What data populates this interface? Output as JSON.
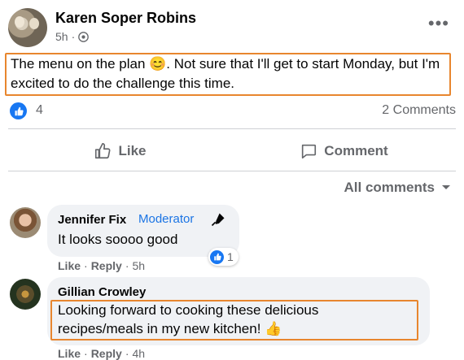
{
  "post": {
    "author": "Karen Soper Robins",
    "time": "5h",
    "separator": "·",
    "text": "The menu on the plan 😊. Not sure that I'll get to start Monday, but I'm excited to do the challenge this time.",
    "reaction_count": "4",
    "comment_count": "2 Comments"
  },
  "actions": {
    "like": "Like",
    "comment": "Comment"
  },
  "comments_filter": "All comments",
  "comments": [
    {
      "name": "Jennifer Fix",
      "badge": "Moderator",
      "text": "It looks soooo good",
      "like": "Like",
      "reply": "Reply",
      "time": "5h",
      "reaction_count": "1"
    },
    {
      "name": "Gillian Crowley",
      "text_line1": "Looking forward to cooking these delicious",
      "text_line2": "recipes/meals in my new kitchen! 👍",
      "like": "Like",
      "reply": "Reply",
      "time": "4h"
    }
  ],
  "colors": {
    "accent": "#1877f2",
    "highlight_box": "#e8862e",
    "muted_text": "#65676b",
    "bubble_bg": "#f0f2f5"
  },
  "icons": [
    "globe-icon",
    "more-options-icon",
    "like-reaction-icon",
    "thumbs-up-icon",
    "comment-icon",
    "chevron-down-icon",
    "moderator-pen-icon"
  ]
}
